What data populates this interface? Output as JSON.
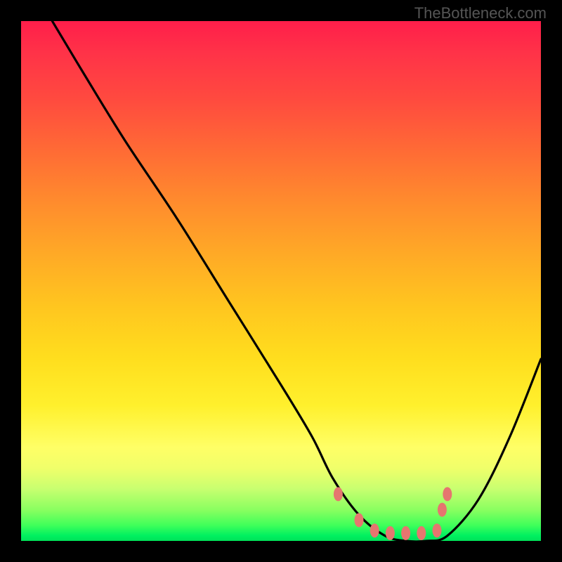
{
  "watermark": "TheBottleneck.com",
  "chart_data": {
    "type": "line",
    "title": "",
    "xlabel": "",
    "ylabel": "",
    "xlim": [
      0,
      100
    ],
    "ylim": [
      0,
      100
    ],
    "series": [
      {
        "name": "bottleneck-curve",
        "x": [
          6,
          12,
          20,
          30,
          40,
          50,
          56,
          60,
          65,
          70,
          74,
          78,
          82,
          88,
          94,
          100
        ],
        "y": [
          100,
          90,
          77,
          62,
          46,
          30,
          20,
          12,
          5,
          1,
          0,
          0,
          1,
          8,
          20,
          35
        ]
      }
    ],
    "markers": {
      "name": "optimal-range",
      "color": "#e5766f",
      "points": [
        {
          "x": 61,
          "y": 9
        },
        {
          "x": 65,
          "y": 4
        },
        {
          "x": 68,
          "y": 2
        },
        {
          "x": 71,
          "y": 1.5
        },
        {
          "x": 74,
          "y": 1.5
        },
        {
          "x": 77,
          "y": 1.5
        },
        {
          "x": 80,
          "y": 2
        },
        {
          "x": 81,
          "y": 6
        },
        {
          "x": 82,
          "y": 9
        }
      ]
    },
    "gradient_scale": {
      "description": "vertical color gradient from red (high bottleneck) to green (no bottleneck)",
      "top_color": "#ff1e4a",
      "bottom_color": "#00e058"
    }
  }
}
